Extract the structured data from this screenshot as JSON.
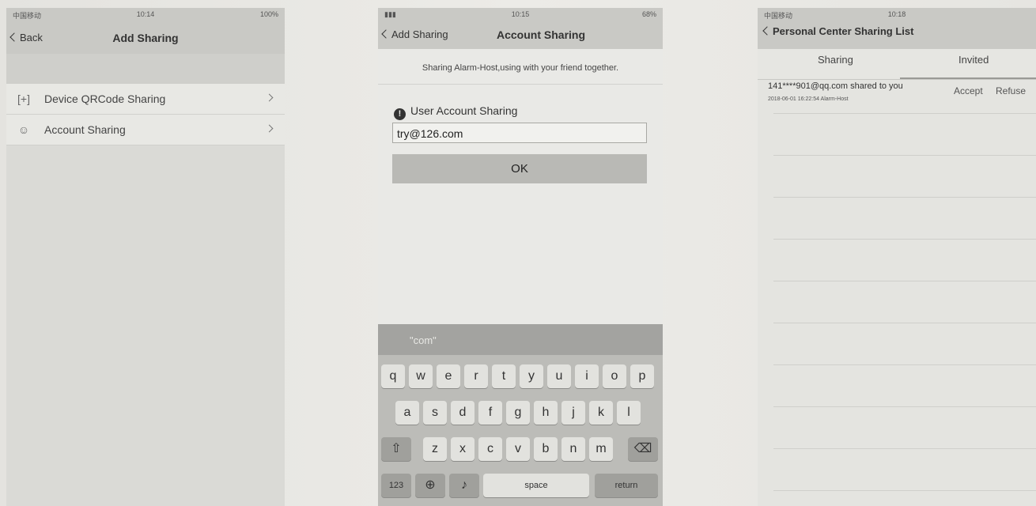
{
  "screen1": {
    "status": {
      "carrier": "中国移动",
      "time": "10:14",
      "battery": "100%"
    },
    "back_label": "Back",
    "title": "Add Sharing",
    "items": [
      {
        "label": "Device QRCode Sharing",
        "icon": "qrcode-scan-icon"
      },
      {
        "label": "Account Sharing",
        "icon": "user-icon"
      }
    ]
  },
  "screen2": {
    "status": {
      "time": "10:15",
      "battery": "68%"
    },
    "back_label": "Add Sharing",
    "title": "Account Sharing",
    "subtitle": "Sharing Alarm-Host,using with your friend together.",
    "section_label": "User Account Sharing",
    "input_value": "try@126.com",
    "ok_label": "OK",
    "keyboard": {
      "suggestion": "\"com\"",
      "row1": [
        "q",
        "w",
        "e",
        "r",
        "t",
        "y",
        "u",
        "i",
        "o",
        "p"
      ],
      "row2": [
        "a",
        "s",
        "d",
        "f",
        "g",
        "h",
        "j",
        "k",
        "l"
      ],
      "row3": [
        "z",
        "x",
        "c",
        "v",
        "b",
        "n",
        "m"
      ],
      "num_label": "123",
      "space_label": "space",
      "return_label": "return"
    }
  },
  "screen3": {
    "status": {
      "carrier": "中国移动",
      "time": "10:18"
    },
    "back_label": "Personal Center Sharing List",
    "tabs": [
      "Sharing",
      "Invited"
    ],
    "invite": {
      "who": "141****901@qq.com shared to you",
      "meta": "2018-06-01 16:22:54  Alarm-Host",
      "accept_label": "Accept",
      "refuse_label": "Refuse"
    }
  }
}
